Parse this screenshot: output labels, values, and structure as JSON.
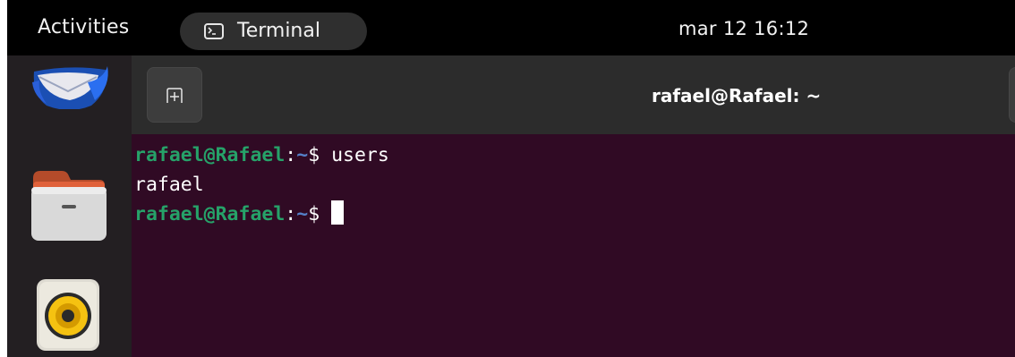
{
  "topbar": {
    "activities_label": "Activities",
    "app_label": "Terminal",
    "app_icon": "terminal-icon",
    "clock": "mar 12  16:12"
  },
  "dock": {
    "items": [
      {
        "icon": "thunderbird-mail-icon"
      },
      {
        "icon": "files-folder-icon"
      },
      {
        "icon": "rhythmbox-speaker-icon"
      }
    ]
  },
  "window": {
    "title": "rafael@Rafael: ~",
    "new_tab_icon": "new-tab-icon"
  },
  "terminal": {
    "lines": [
      {
        "user": "rafael@Rafael",
        "sep": ":",
        "path": "~",
        "prompt": "$ ",
        "command": "users"
      },
      {
        "output": "rafael"
      },
      {
        "user": "rafael@Rafael",
        "sep": ":",
        "path": "~",
        "prompt": "$ ",
        "command": ""
      }
    ]
  },
  "colors": {
    "terminal_bg": "#300a24",
    "prompt_user": "#26a269",
    "prompt_path": "#5580c8",
    "titlebar_bg": "#2c2c2c",
    "topbar_bg": "#000000"
  }
}
